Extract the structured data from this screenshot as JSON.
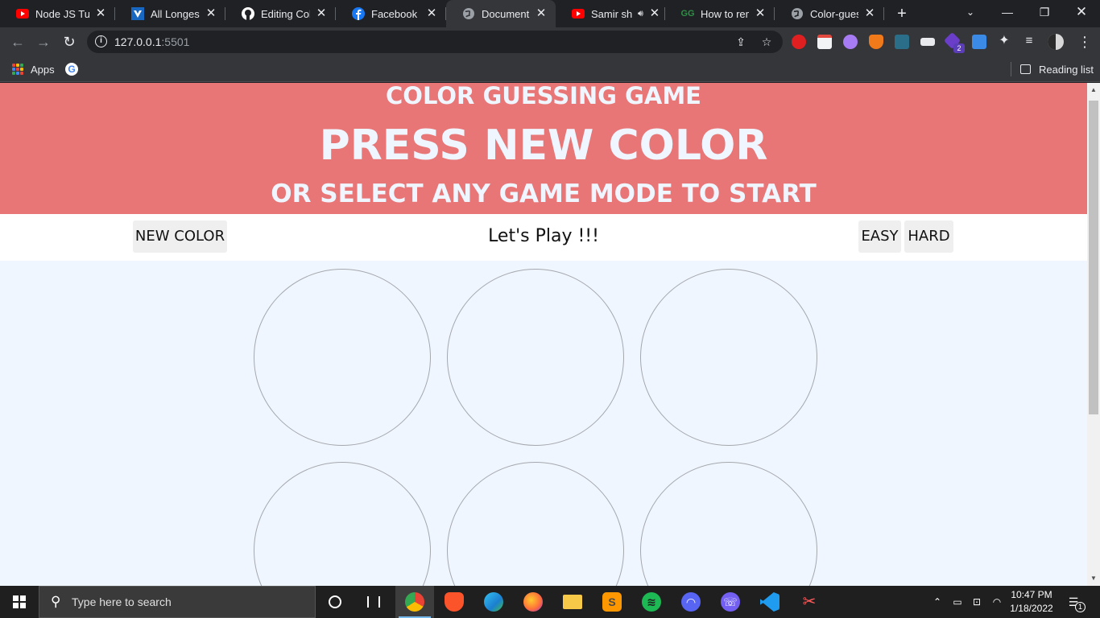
{
  "browser": {
    "tabs": [
      {
        "title": "Node JS Tutorial",
        "favicon": "youtube-icon",
        "color": "#ff0000"
      },
      {
        "title": "All Longest Sta",
        "favicon": "vuetify-icon",
        "color": "#1867c0"
      },
      {
        "title": "Editing Color-g",
        "favicon": "github-icon",
        "color": "#ffffff"
      },
      {
        "title": "Facebook",
        "favicon": "facebook-icon",
        "color": "#1877f2"
      },
      {
        "title": "Document",
        "favicon": "globe-icon",
        "color": "#9aa0a6",
        "active": true
      },
      {
        "title": "Samir shr",
        "favicon": "youtube-icon",
        "color": "#ff0000",
        "audio": true
      },
      {
        "title": "How to remov",
        "favicon": "geeksforgeeks-icon",
        "color": "#2f8d46"
      },
      {
        "title": "Color-guessin",
        "favicon": "globe-icon",
        "color": "#9aa0a6"
      }
    ],
    "url_host": "127.0.0.1",
    "url_port": ":5501",
    "bookmarks": {
      "apps_label": "Apps",
      "reading_list_label": "Reading list"
    },
    "extension_badge": "2"
  },
  "game": {
    "title": "COLOR GUESSING GAME",
    "headline": "PRESS NEW COLOR",
    "subheadline": "OR SELECT ANY GAME MODE TO START",
    "header_color": "#e87676",
    "new_color_label": "NEW COLOR",
    "message": "Let's Play !!!",
    "easy_label": "EASY",
    "hard_label": "HARD",
    "square_count": 6,
    "square_color": "#eff6ff"
  },
  "taskbar": {
    "search_placeholder": "Type here to search",
    "time": "10:47 PM",
    "date": "1/18/2022",
    "notification_count": "1"
  }
}
